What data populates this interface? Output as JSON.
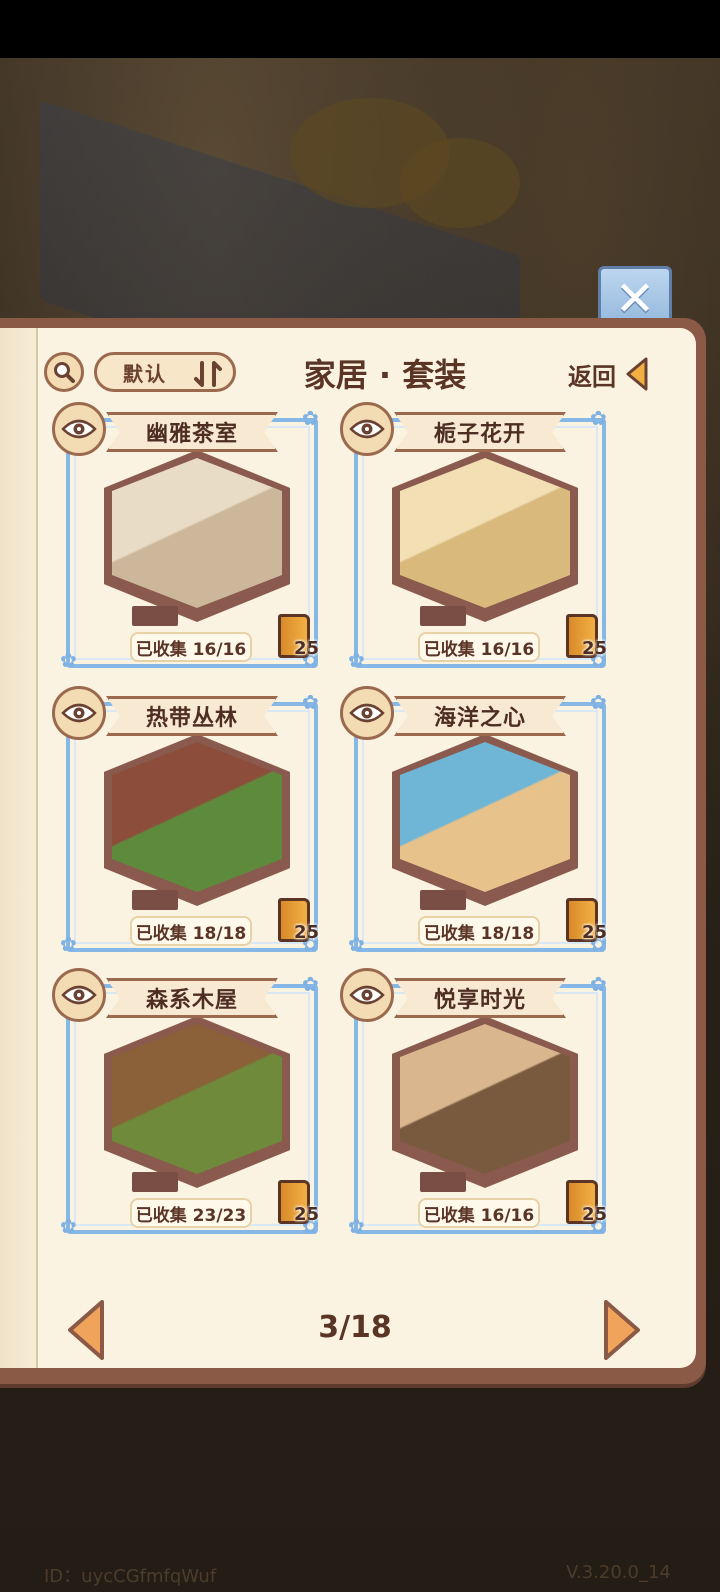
{
  "header": {
    "sort_label": "默认",
    "title": "家居 · 套装",
    "back_label": "返回"
  },
  "cards": [
    {
      "name": "幽雅茶室",
      "collected": "已收集 16/16",
      "reward": "25",
      "theme": [
        "#e9dcc6",
        "#cdb79a"
      ]
    },
    {
      "name": "栀子花开",
      "collected": "已收集 16/16",
      "reward": "25",
      "theme": [
        "#f2dfb4",
        "#d9b97c"
      ]
    },
    {
      "name": "热带丛林",
      "collected": "已收集 18/18",
      "reward": "25",
      "theme": [
        "#8c4e3a",
        "#5e8a3c"
      ]
    },
    {
      "name": "海洋之心",
      "collected": "已收集 18/18",
      "reward": "25",
      "theme": [
        "#6fb6d6",
        "#e7c28a"
      ]
    },
    {
      "name": "森系木屋",
      "collected": "已收集 23/23",
      "reward": "25",
      "theme": [
        "#8a6138",
        "#6e8a3a"
      ]
    },
    {
      "name": "悦享时光",
      "collected": "已收集 16/16",
      "reward": "25",
      "theme": [
        "#d9b68e",
        "#7a5a3e"
      ]
    }
  ],
  "pagination": {
    "label": "3/18"
  },
  "footer": {
    "id": "ID：uycCGfmfqWuf",
    "version": "V.3.20.0_14"
  },
  "icons": {
    "close": "close-icon",
    "search": "search-icon",
    "sort": "sort-icon",
    "back": "triangle-left-icon",
    "eye": "eye-icon",
    "reward": "book-icon",
    "prev": "arrow-left-icon",
    "next": "arrow-right-icon"
  },
  "colors": {
    "frame_blue": "#85b8e6",
    "text_brown": "#5a3526",
    "page_bg": "#fbf3e1",
    "reward_orange": "#f2b043"
  }
}
